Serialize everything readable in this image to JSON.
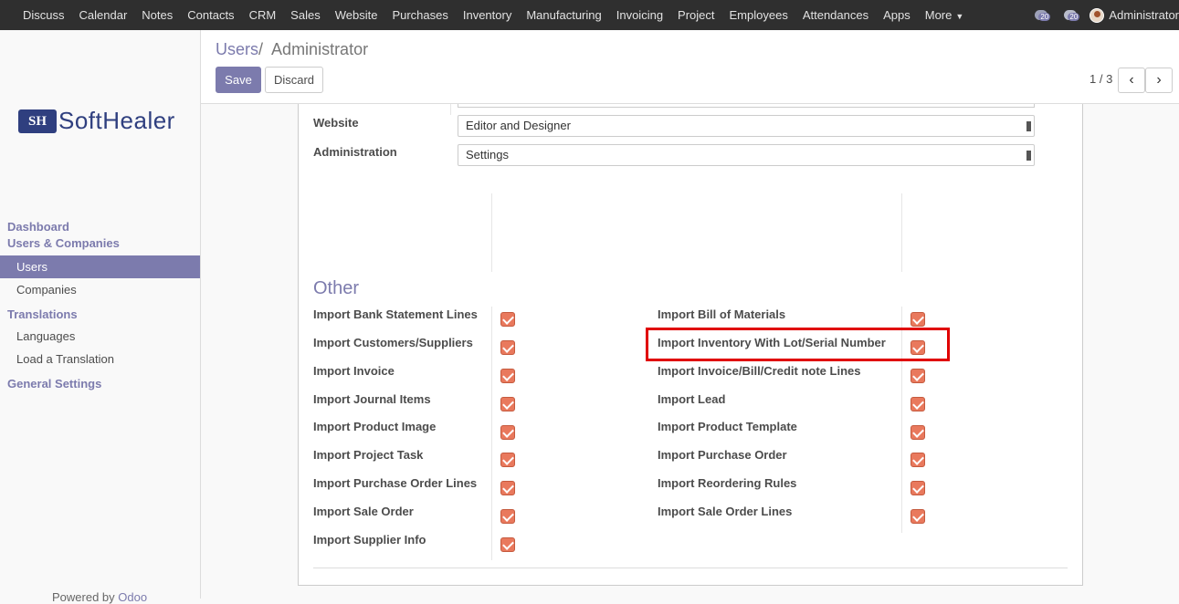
{
  "topbar": {
    "menu": [
      "Discuss",
      "Calendar",
      "Notes",
      "Contacts",
      "CRM",
      "Sales",
      "Website",
      "Purchases",
      "Inventory",
      "Manufacturing",
      "Invoicing",
      "Project",
      "Employees",
      "Attendances",
      "Apps",
      "More"
    ],
    "activity_count": "20",
    "message_count": "20",
    "user_name": "Administrator"
  },
  "sidebar": {
    "logo_mark": "SH",
    "logo_text": "SoftHealer",
    "sections": [
      {
        "title": "Dashboard"
      },
      {
        "title": "Users & Companies",
        "items": [
          "Users",
          "Companies"
        ]
      },
      {
        "title": "Translations",
        "items": [
          "Languages",
          "Load a Translation"
        ]
      },
      {
        "title": "General Settings"
      }
    ],
    "active_item": "Users",
    "powered_prefix": "Powered by",
    "powered_brand": "Odoo"
  },
  "control_panel": {
    "breadcrumb_parent": "Users",
    "breadcrumb_sep": "/",
    "breadcrumb_current": "Administrator",
    "save_label": "Save",
    "discard_label": "Discard",
    "pager": "1 / 3",
    "prev": "‹",
    "next": "›"
  },
  "form": {
    "fields": [
      {
        "label": "Website",
        "value": "Editor and Designer"
      },
      {
        "label": "Administration",
        "value": "Settings"
      }
    ],
    "section_title": "Other",
    "left_checks": [
      "Import Bank Statement Lines",
      "Import Customers/Suppliers",
      "Import Invoice",
      "Import Journal Items",
      "Import Product Image",
      "Import Project Task",
      "Import Purchase Order Lines",
      "Import Sale Order",
      "Import Supplier Info"
    ],
    "right_checks": [
      "Import Bill of Materials",
      "Import Inventory With Lot/Serial Number",
      "Import Invoice/Bill/Credit note Lines",
      "Import Lead",
      "Import Product Template",
      "Import Purchase Order",
      "Import Reordering Rules",
      "Import Sale Order Lines"
    ],
    "highlight_color": "#e00000",
    "checkbox_color": "#e9795d"
  }
}
